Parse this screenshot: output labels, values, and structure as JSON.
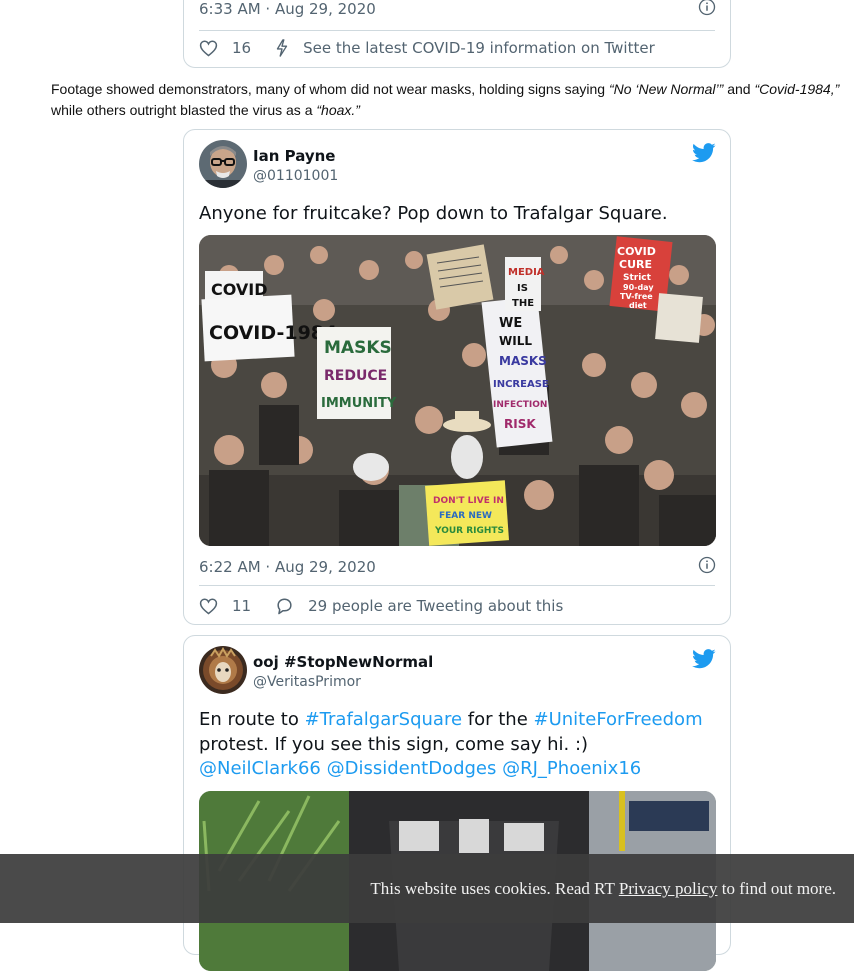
{
  "tweet1": {
    "timestamp": "6:33 AM · Aug 29, 2020",
    "likes": "16",
    "covid_link": "See the latest COVID-19 information on Twitter"
  },
  "article": {
    "p1_a": "Footage showed demonstrators, many of whom did not wear masks, holding signs saying ",
    "p1_q1": "“No ‘New Normal’”",
    "p1_b": " and ",
    "p1_q2": "“Covid-1984,”",
    "p1_c": " while others outright blasted the virus as a ",
    "p1_q3": "“hoax.”"
  },
  "tweet2": {
    "author_name": "Ian Payne",
    "author_handle": "@01101001",
    "text": "Anyone for fruitcake? Pop down to Trafalgar Square.",
    "timestamp": "6:22 AM · Aug 29, 2020",
    "likes": "11",
    "replies_text": "29 people are Tweeting about this",
    "photo_signs": {
      "covid_top": "COVID",
      "covid1984": "COVID-1984",
      "masks1": "MASKS",
      "masks2": "REDUCE",
      "masks3": "IMMUNITY",
      "we": "WE",
      "will": "WILL",
      "masks_inc": "MASKS",
      "increase": "INCREASE",
      "infection": "INFECTION",
      "risk": "RISK",
      "media1": "MEDIA",
      "media2": "IS",
      "media3": "THE",
      "cure1": "COVID",
      "cure2": "CURE",
      "cure3": "Strict",
      "cure4": "90-day",
      "cure5": "TV-free",
      "cure6": "diet",
      "dont1": "DON'T LIVE IN",
      "dont2": "FEAR NEW",
      "dont3": "YOUR RIGHTS"
    }
  },
  "tweet3": {
    "author_name": "ooj #StopNewNormal",
    "author_handle": "@VeritasPrimor",
    "line1_a": "En route to ",
    "line1_tag1": "#TrafalgarSquare",
    "line1_b": " for the ",
    "line1_tag2": "#UniteForFreedom",
    "line2": "protest. If you see this sign, come say hi. :)",
    "mention1": "@NeilClark66",
    "mention2": "@DissidentDodges",
    "mention3": "@RJ_Phoenix16"
  },
  "cookie": {
    "text_a": "This website uses cookies. Read RT ",
    "link": "Privacy policy",
    "text_b": " to find out more."
  },
  "colors": {
    "twitter_blue": "#1d9bf0",
    "cookie_bg": "#3c3c3c"
  }
}
